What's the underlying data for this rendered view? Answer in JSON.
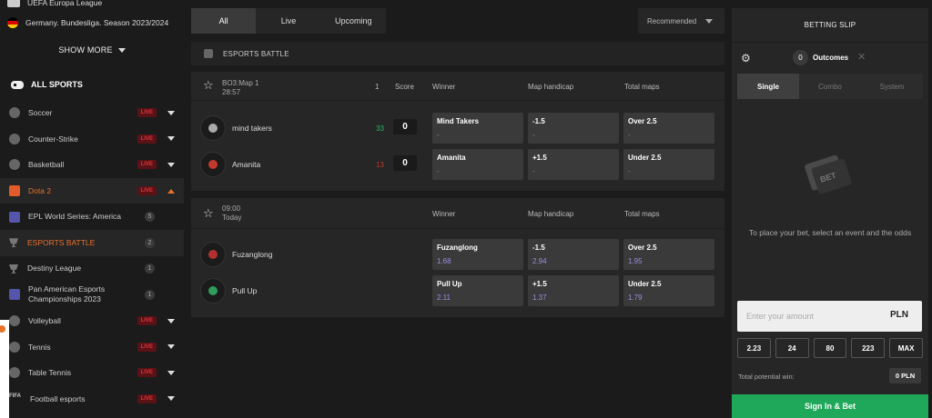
{
  "sidebar": {
    "leagues": [
      {
        "label": "UEFA Europa League"
      },
      {
        "label": "Germany. Bundesliga. Season 2023/2024"
      }
    ],
    "show_more": "SHOW MORE",
    "all_sports": "ALL SPORTS",
    "live_label": "LIVE",
    "sports_top": [
      {
        "label": "Soccer",
        "icon": "soccer-ball-icon"
      },
      {
        "label": "Counter-Strike",
        "icon": "counter-strike-icon"
      },
      {
        "label": "Basketball",
        "icon": "basketball-icon"
      },
      {
        "label": "Dota 2",
        "icon": "dota2-icon"
      }
    ],
    "dota_subs": [
      {
        "label": "EPL World Series: America",
        "count": "5"
      },
      {
        "label": "ESPORTS BATTLE",
        "count": "2"
      },
      {
        "label": "Destiny League",
        "count": "1"
      },
      {
        "label": "Pan American Esports Championships 2023",
        "count": "1"
      }
    ],
    "sports_bottom": [
      {
        "label": "Volleyball",
        "icon": "volleyball-icon"
      },
      {
        "label": "Tennis",
        "icon": "tennis-icon"
      },
      {
        "label": "Table Tennis",
        "icon": "table-tennis-icon"
      },
      {
        "label": "Football esports",
        "icon": "fifa-icon"
      }
    ]
  },
  "main": {
    "filters": [
      "All",
      "Live",
      "Upcoming"
    ],
    "sort": "Recommended",
    "section": "ESPORTS BATTLE",
    "columns": {
      "map": "1",
      "score": "Score",
      "winner": "Winner",
      "handicap": "Map handicap",
      "total": "Total maps"
    },
    "match1": {
      "line1": "BO3:Map 1",
      "line2": "28:57",
      "teams": [
        {
          "name": "mind takers",
          "map_score": "33",
          "score": "0",
          "winner": {
            "label": "Mind Takers",
            "value": "-"
          },
          "handicap": {
            "label": "-1.5",
            "value": "-"
          },
          "total": {
            "label": "Over 2.5",
            "value": "-"
          }
        },
        {
          "name": "Amanita",
          "map_score": "13",
          "score": "0",
          "winner": {
            "label": "Amanita",
            "value": "-"
          },
          "handicap": {
            "label": "+1.5",
            "value": "-"
          },
          "total": {
            "label": "Under 2.5",
            "value": "-"
          }
        }
      ]
    },
    "match2": {
      "line1": "09:00",
      "line2": "Today",
      "teams": [
        {
          "name": "Fuzanglong",
          "winner": {
            "label": "Fuzanglong",
            "value": "1.68"
          },
          "handicap": {
            "label": "-1.5",
            "value": "2.94"
          },
          "total": {
            "label": "Over 2.5",
            "value": "1.95"
          }
        },
        {
          "name": "Pull Up",
          "winner": {
            "label": "Pull Up",
            "value": "2.11"
          },
          "handicap": {
            "label": "+1.5",
            "value": "1.37"
          },
          "total": {
            "label": "Under 2.5",
            "value": "1.79"
          }
        }
      ]
    }
  },
  "slip": {
    "title": "BETTING SLIP",
    "outcomes_count": "0",
    "outcomes_label": "Outcomes",
    "tabs": [
      "Single",
      "Combo",
      "System"
    ],
    "hint": "To place your bet, select an event and the odds",
    "amount_placeholder": "Enter your amount",
    "currency": "PLN",
    "quick_amounts": [
      "2.23",
      "24",
      "80",
      "223",
      "MAX"
    ],
    "potential_label": "Total potential win:",
    "potential_value": "0 PLN",
    "signin": "Sign In & Bet"
  },
  "colors": {
    "accent": "#e8702a",
    "live": "#e0333a",
    "odds": "#9a8fe0",
    "signin": "#1fa85a"
  }
}
